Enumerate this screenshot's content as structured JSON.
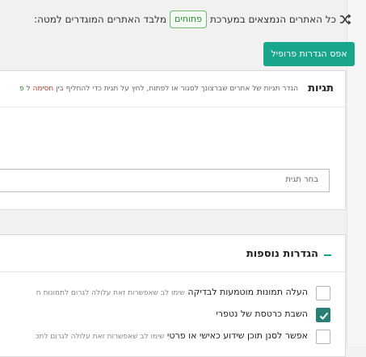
{
  "top": {
    "text_before": "כל האתרים הנמצאים במערכת",
    "pill": "פתוחים",
    "text_after": "מלבד האתרים המוגדרים למטה:",
    "icon": "shuffle-icon"
  },
  "reset_button": {
    "label": "אפס הגדרות פרופיל"
  },
  "tags": {
    "title": "תגיות",
    "description": "הגדר תגיות של אתרים שברצונך לסגור או לפתוח, לחץ על תגית כדי להחליף בין",
    "red_word": "חסימה",
    "connector": "ל",
    "green_word": "פ",
    "select_placeholder": "בחר תגית"
  },
  "more": {
    "title": "הגדרות נוספות",
    "icon": "minus-icon",
    "options": [
      {
        "label": "העלה תמונות מוטמעות לבדיקה",
        "note": "שימו לב שאפשרות זאת עלולה לגרום לתמונות ח",
        "checked": false
      },
      {
        "label": "השבת כרטסת של נטפרי",
        "note": "",
        "checked": true
      },
      {
        "label": "אפשר לסנן תוכן שידוע כאישי או פרטי",
        "note": "שימו לב שאפשרות זאת עלולה לגרום לתכ",
        "checked": false
      }
    ]
  },
  "colors": {
    "accent": "#18a78a",
    "checked": "#2c7f77",
    "red": "#c0392b",
    "green": "#2a8a2a"
  }
}
